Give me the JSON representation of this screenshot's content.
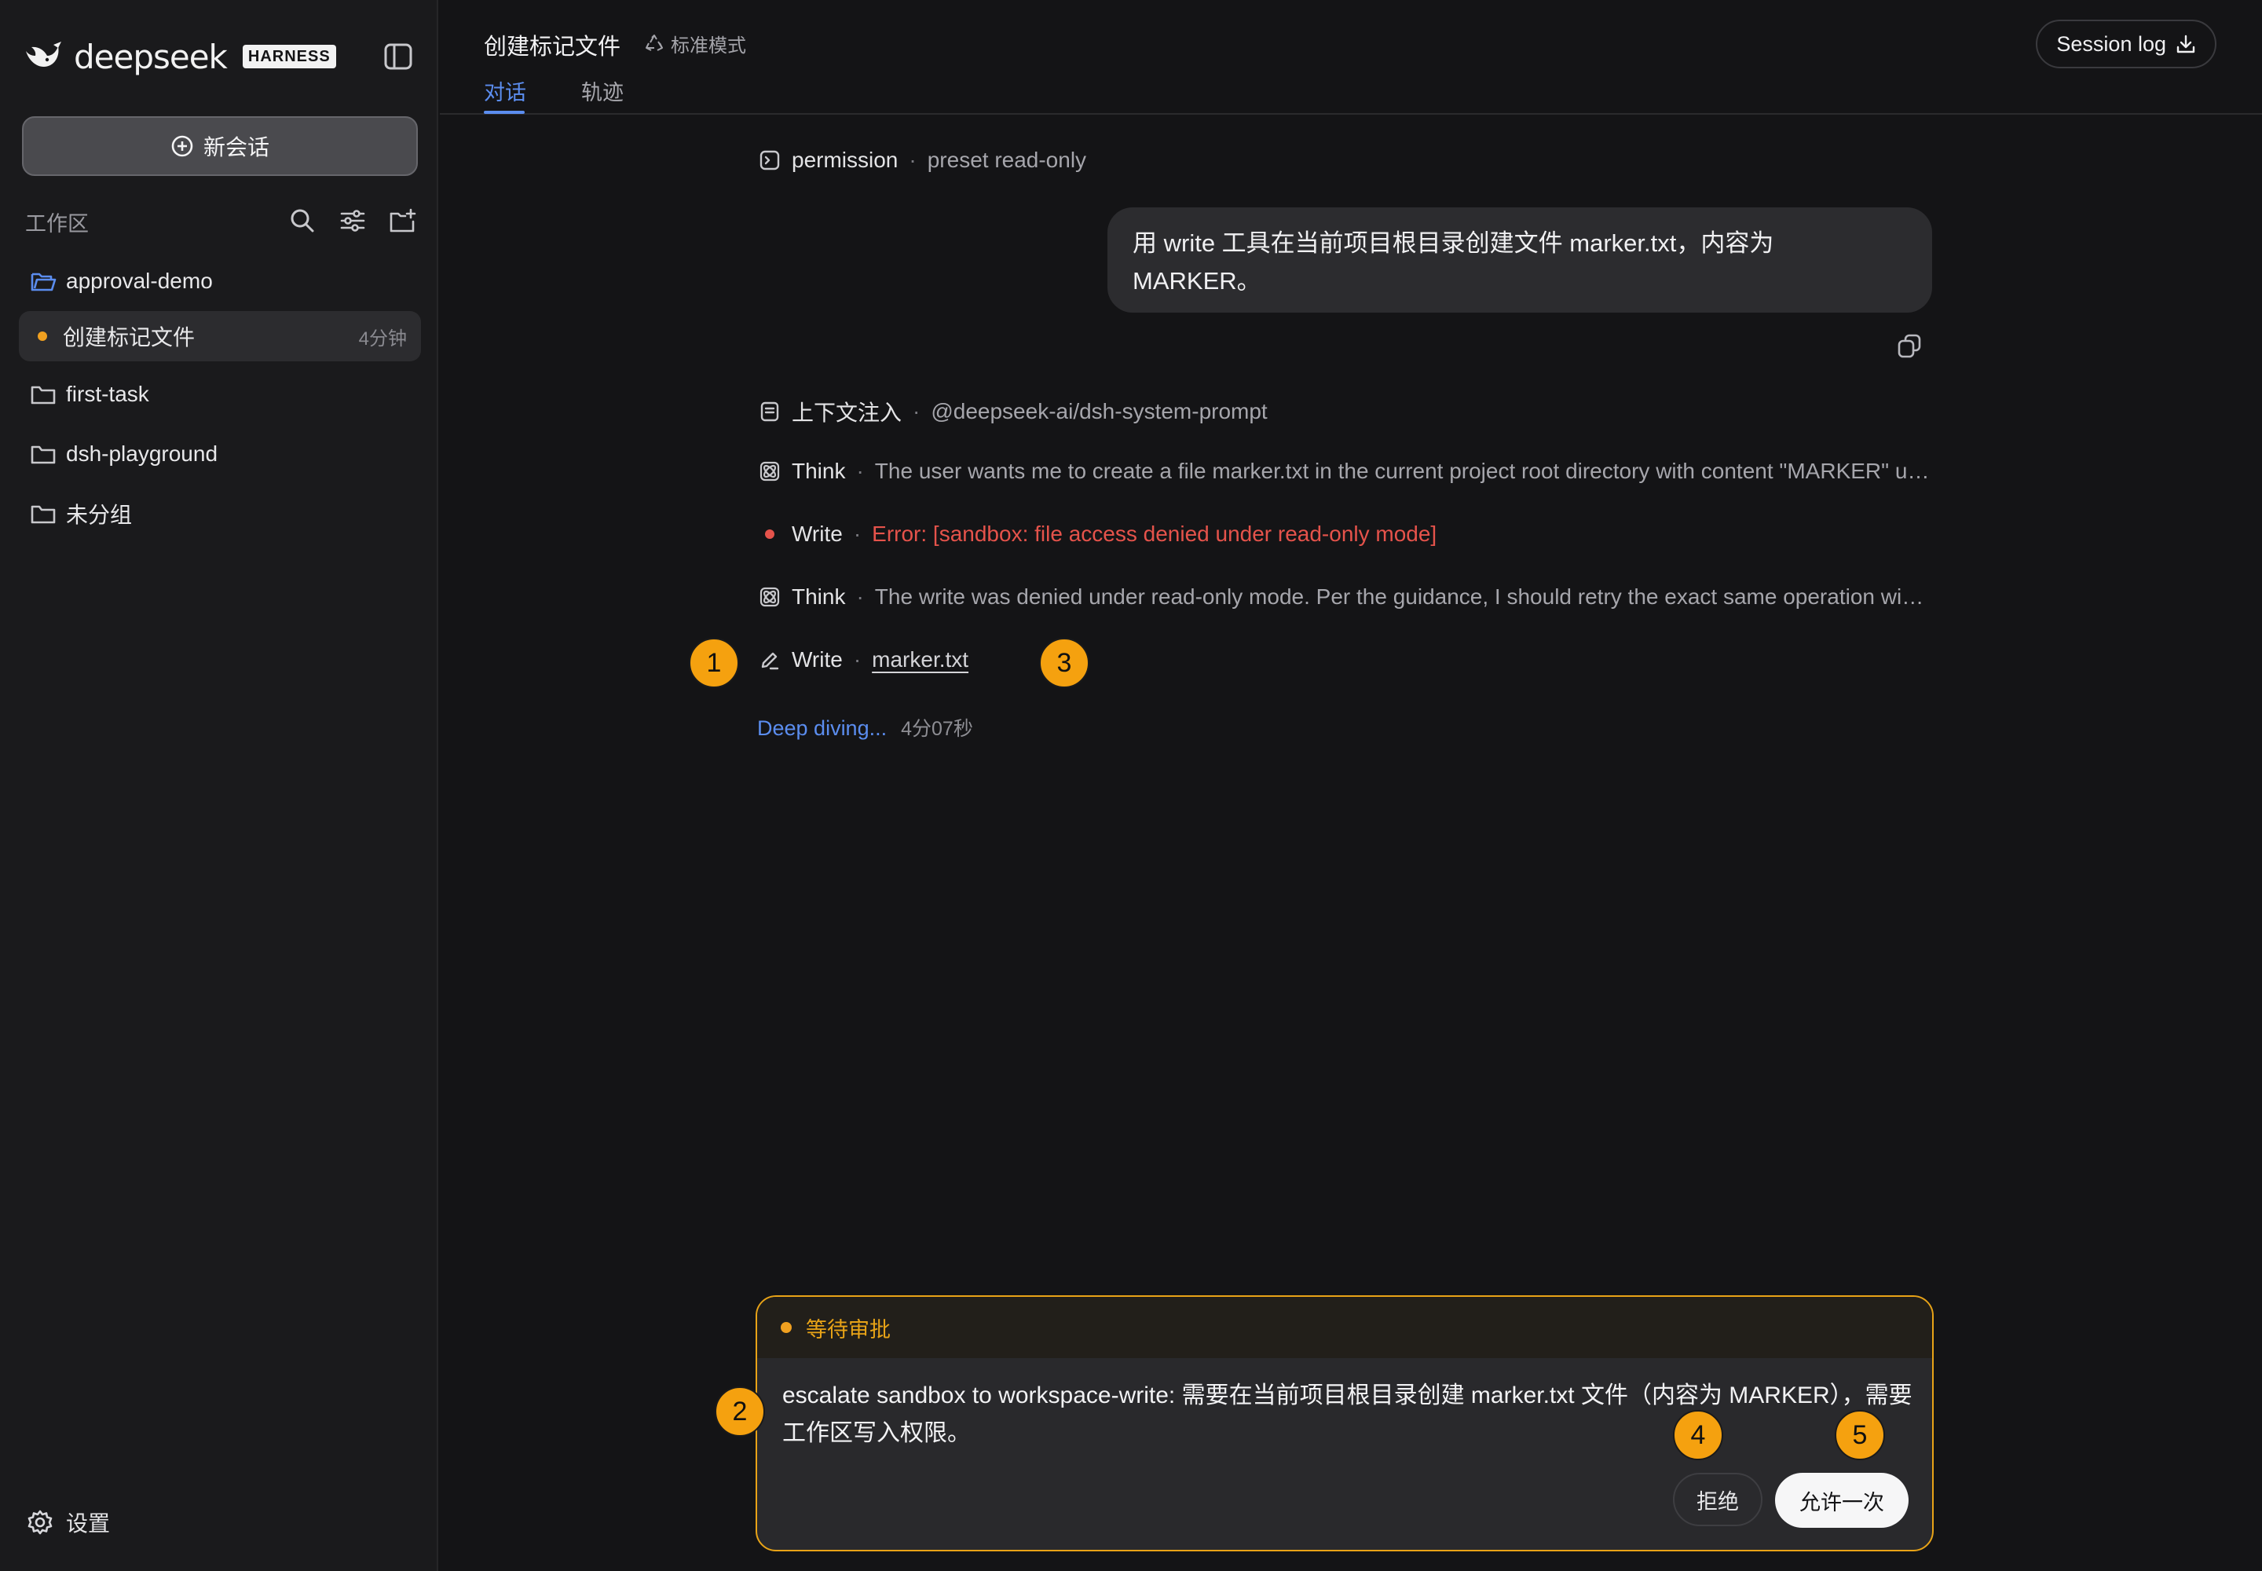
{
  "brand": {
    "name": "deepseek",
    "badge": "HARNESS"
  },
  "sidebar": {
    "new_chat_label": "新会话",
    "workspace_title": "工作区",
    "items": [
      {
        "label": "approval-demo",
        "icon": "folder-open-icon"
      },
      {
        "label": "创建标记文件",
        "time": "4分钟",
        "status": "running"
      },
      {
        "label": "first-task",
        "icon": "folder-icon"
      },
      {
        "label": "dsh-playground",
        "icon": "folder-icon"
      },
      {
        "label": "未分组",
        "icon": "folder-icon"
      }
    ],
    "settings_label": "设置"
  },
  "header": {
    "title": "创建标记文件",
    "mode": "标准模式",
    "tabs": [
      {
        "label": "对话"
      },
      {
        "label": "轨迹"
      }
    ],
    "session_log_label": "Session log"
  },
  "conversation": {
    "permission": {
      "name": "permission",
      "detail": "preset read-only"
    },
    "user_message": "用 write 工具在当前项目根目录创建文件 marker.txt，内容为 MARKER。",
    "steps": [
      {
        "name": "上下文注入",
        "detail": "@deepseek-ai/dsh-system-prompt"
      },
      {
        "name": "Think",
        "detail": "The user wants me to create a file marker.txt in the current project root directory with content \"MARKER\" using the write tool. Let me proceed with this task."
      },
      {
        "name": "Write",
        "detail": "Error: [sandbox: file access denied under read-only mode]"
      },
      {
        "name": "Think",
        "detail": "The write was denied under read-only mode. Per the guidance, I should retry the exact same operation with escalated permissions."
      },
      {
        "name": "Write",
        "detail": "marker.txt"
      }
    ],
    "status_label": "Deep diving...",
    "elapsed": "4分07秒"
  },
  "approval": {
    "title": "等待审批",
    "message": "escalate sandbox to workspace-write: 需要在当前项目根目录创建 marker.txt 文件（内容为 MARKER），需要工作区写入权限。",
    "reject_label": "拒绝",
    "allow_label": "允许一次"
  },
  "markers": [
    "1",
    "2",
    "3",
    "4",
    "5"
  ],
  "colors": {
    "accent_blue": "#5B8DEF",
    "accent_orange": "#E8A317",
    "error_red": "#E5534B",
    "background": "#141416",
    "sidebar": "#1A1A1C"
  }
}
